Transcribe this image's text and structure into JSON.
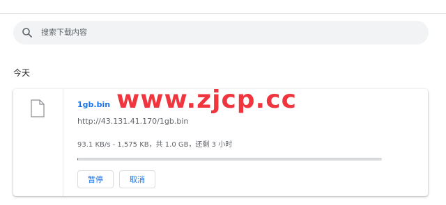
{
  "search": {
    "placeholder": "搜索下载内容"
  },
  "section": {
    "label": "今天"
  },
  "download": {
    "file_name": "1gb.bin",
    "url": "http://43.131.41.170/1gb.bin",
    "status": "93.1 KB/s - 1,575 KB，共 1.0 GB，还剩 3 小时",
    "progress_fraction": 0.0015,
    "pause_label": "暂停",
    "cancel_label": "取消"
  },
  "watermark": {
    "text": "www.zjcp.cc"
  },
  "colors": {
    "accent": "#1a73e8",
    "watermark": "#f0353e",
    "search_bg": "#f1f3f4"
  },
  "icons": {
    "search": "search-icon",
    "file": "file-icon"
  }
}
